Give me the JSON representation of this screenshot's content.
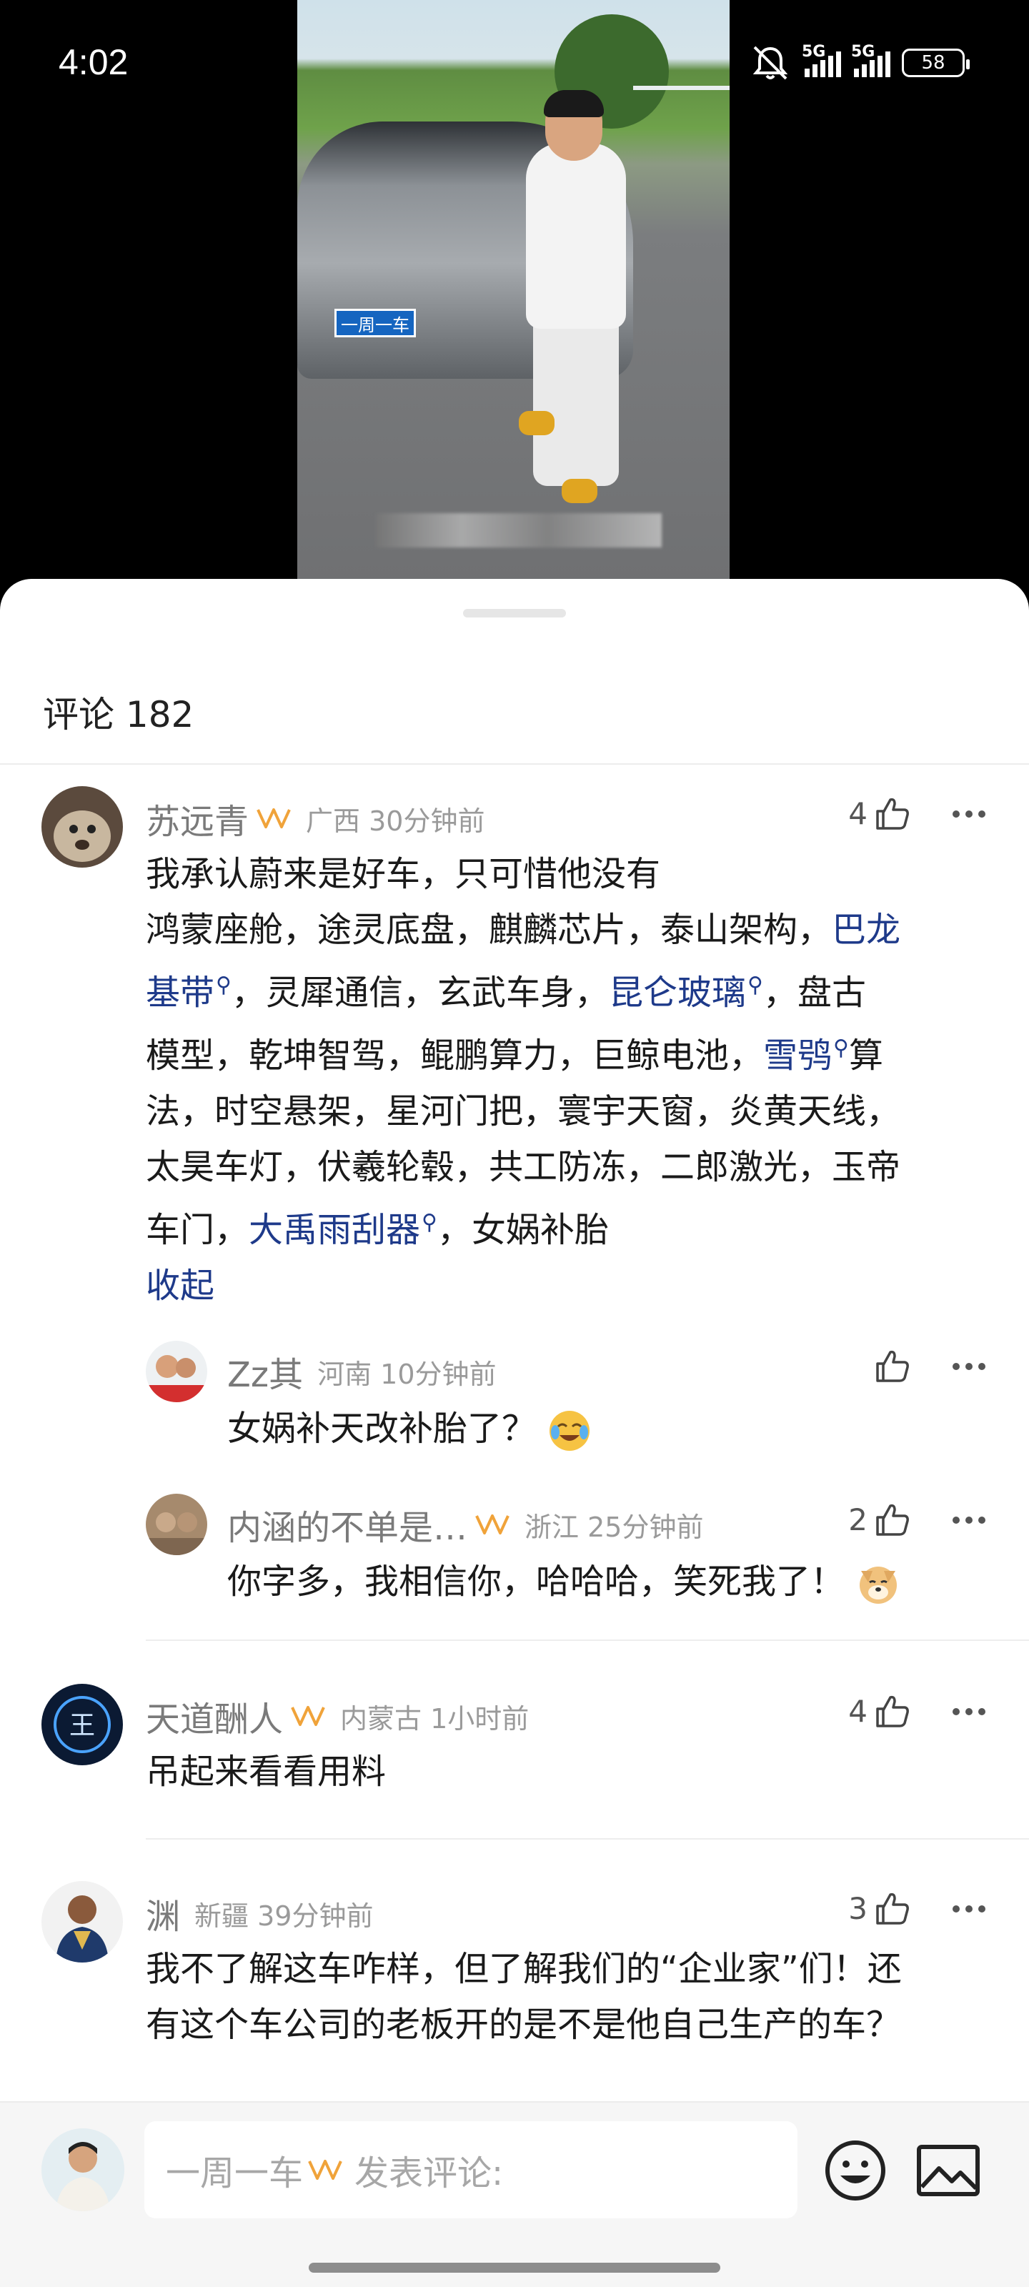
{
  "status_bar": {
    "time": "4:02",
    "signal_1_label": "5G",
    "signal_2_label": "5G",
    "battery": "58"
  },
  "video": {
    "plate_text": "一周一车"
  },
  "comments_header": {
    "title": "评论 182"
  },
  "comments": [
    {
      "name": "苏远青",
      "location": "广西 30分钟前",
      "likes": "4",
      "text_line1": "我承认蔚来是好车，只可惜他没有",
      "text_line2": "鸿蒙座舱，途灵底盘，麒麟芯片，泰山架构，",
      "kw_1": "巴龙",
      "kw_1b": "基带",
      "text_line3b": "，灵犀通信，玄武车身，",
      "kw_2": "昆仑玻璃",
      "text_line3c": "，盘古",
      "text_line4a": "模型，乾坤智驾，鲲鹏算力，巨鲸电池，",
      "kw_3": "雪鸮",
      "text_line4b": "算",
      "text_line5": "法，时空悬架，星河门把，寰宇天窗，炎黄天线，",
      "text_line6": "太昊车灯，伏羲轮毂，共工防冻，二郎激光，玉帝",
      "text_line7a": "车门，",
      "kw_4": "大禹雨刮器",
      "text_line7b": "，女娲补胎",
      "collapse": "收起",
      "search_mark": "⚲"
    },
    {
      "name": "Zz其",
      "location": "河南 10分钟前",
      "text": "女娲补天改补胎了？"
    },
    {
      "name": "内涵的不单是…",
      "location": "浙江 25分钟前",
      "likes": "2",
      "text": "你字多，我相信你，哈哈哈，笑死我了！"
    },
    {
      "name": "天道酬人",
      "location": "内蒙古 1小时前",
      "likes": "4",
      "text": "吊起来看看用料"
    },
    {
      "name": "渊",
      "location": "新疆 39分钟前",
      "likes": "3",
      "text_line1": "我不了解这车咋样，但了解我们的“企业家”们！还",
      "text_line2": "有这个车公司的老板开的是不是他自己生产的车？"
    }
  ],
  "input_bar": {
    "account_name": "一周一车",
    "placeholder": "发表评论:"
  },
  "colors": {
    "keyword_blue": "#1e3a8a",
    "vip_orange": "#f0a33a"
  }
}
